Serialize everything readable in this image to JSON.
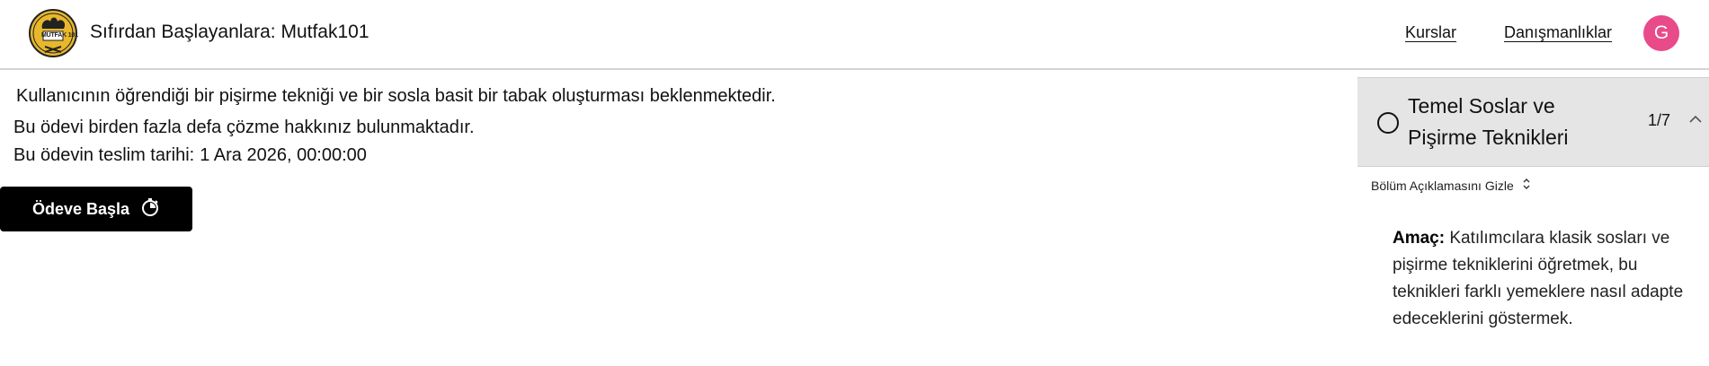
{
  "header": {
    "logo_text": "MUTFAK 101",
    "site_title": "Sıfırdan Başlayanlara: Mutfak101",
    "nav": [
      {
        "label": "Kurslar"
      },
      {
        "label": "Danışmanlıklar"
      }
    ],
    "avatar_initial": "G",
    "avatar_color": "#e84a8a"
  },
  "assignment": {
    "description": "Kullanıcının öğrendiği bir pişirme tekniği ve bir sosla basit bir tabak oluşturması beklenmektedir.",
    "multiple_attempts": "Bu ödevi birden fazla defa çözme hakkınız bulunmaktadır.",
    "due_label": "Bu ödevin teslim tarihi:",
    "due_value": "1 Ara 2026, 00:00:00",
    "start_button": "Ödeve Başla"
  },
  "sidebar": {
    "section_title": "Temel Soslar ve Pişirme Teknikleri",
    "section_count": "1/7",
    "toggle_description": "Bölüm Açıklamasını Gizle",
    "objective_label": "Amaç:",
    "objective_text": "Katılımcılara klasik sosları ve pişirme tekniklerini öğretmek, bu teknikleri farklı yemeklere nasıl adapte edeceklerini göstermek."
  },
  "icons": {
    "logo": "chef-hat-logo-icon",
    "start": "timer-icon",
    "collapse": "chevron-up-icon",
    "toggle": "chevron-up-down-icon",
    "status": "circle-outline-icon"
  }
}
